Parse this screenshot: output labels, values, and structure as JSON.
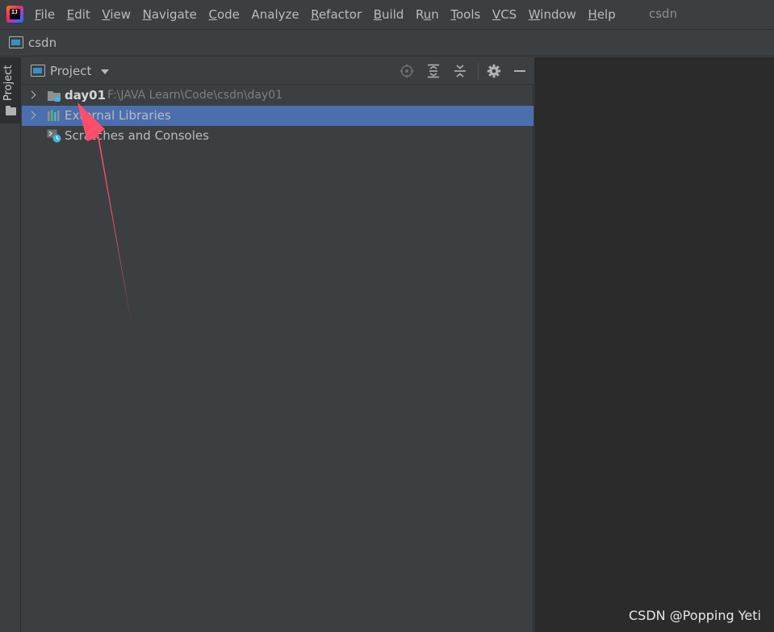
{
  "menubar": {
    "logo_text": "IJ",
    "items": [
      {
        "mnemonic": "F",
        "rest": "ile"
      },
      {
        "mnemonic": "E",
        "rest": "dit"
      },
      {
        "mnemonic": "V",
        "rest": "iew"
      },
      {
        "mnemonic": "N",
        "rest": "avigate"
      },
      {
        "mnemonic": "C",
        "rest": "ode"
      },
      {
        "mnemonic": "",
        "rest": "Analyze"
      },
      {
        "mnemonic": "R",
        "rest": "efactor"
      },
      {
        "mnemonic": "B",
        "rest": "uild"
      },
      {
        "mnemonic": "",
        "rest": "Run",
        "underline_index": 1
      },
      {
        "mnemonic": "T",
        "rest": "ools"
      },
      {
        "mnemonic": "",
        "rest": "VCS",
        "underline_index": 0
      },
      {
        "mnemonic": "W",
        "rest": "indow"
      },
      {
        "mnemonic": "H",
        "rest": "elp"
      }
    ],
    "window_title": "csdn"
  },
  "navbar": {
    "crumb_label": "csdn"
  },
  "left_strip": {
    "tab_label": "Project"
  },
  "project_panel": {
    "title": "Project",
    "tree": [
      {
        "label": "day01",
        "path": "F:\\JAVA Learn\\Code\\csdn\\day01",
        "icon": "module-folder-icon",
        "expandable": true,
        "selected": false,
        "bold": true
      },
      {
        "label": "External Libraries",
        "path": "",
        "icon": "library-icon",
        "expandable": true,
        "selected": true,
        "bold": false
      },
      {
        "label": "Scratches and Consoles",
        "path": "",
        "icon": "scratches-icon",
        "expandable": false,
        "selected": false,
        "bold": false
      }
    ]
  },
  "watermark": "CSDN @Popping Yeti",
  "colors": {
    "background": "#3c3f41",
    "editor": "#2b2b2b",
    "selection": "#4b6eaf",
    "accent_blue": "#3592c4",
    "arrow": "#ff4d6a"
  }
}
